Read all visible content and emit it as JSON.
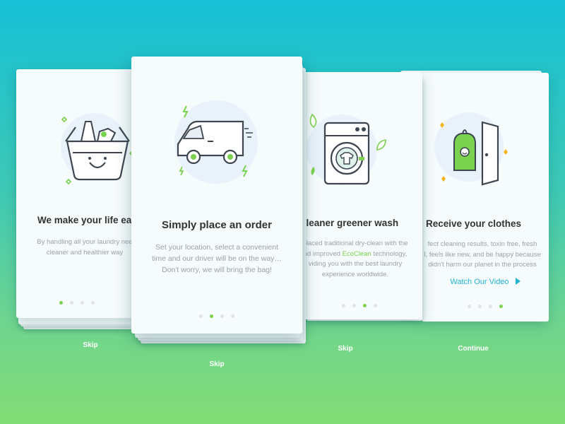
{
  "cards": [
    {
      "title": "We make your life eas",
      "desc": "By handling all your laundry nee\ncleaner and healthier way",
      "skip": "Skip"
    },
    {
      "title": "Simply place an order",
      "desc": "Set your location, select a convenient\ntime and our driver will be on the way…\nDon't worry, we will bring the bag!",
      "skip": "Skip"
    },
    {
      "title": "cleaner greener wash",
      "desc_a": "placed traditional dry-clean with the\nnd improved ",
      "desc_highlight": "EcoClean",
      "desc_b": " technology,\nviding you with the best laundry\nexperience worldwide.",
      "skip": "Skip"
    },
    {
      "title": "Receive your clothes",
      "desc": "fect cleaning results, toxin free, fresh\nl, feels like new, and be happy because\ndidn't harm our planet in the process",
      "video": "Watch Our Video",
      "continue": "Continue"
    }
  ],
  "icons": [
    "laundry-basket-icon",
    "delivery-van-icon",
    "washing-machine-icon",
    "clothes-bag-door-icon",
    "play-arrow-icon"
  ],
  "colors": {
    "accent": "#7bd24e",
    "link": "#25b3d3",
    "circle": "#e9f2fb",
    "line": "#3d4650"
  }
}
